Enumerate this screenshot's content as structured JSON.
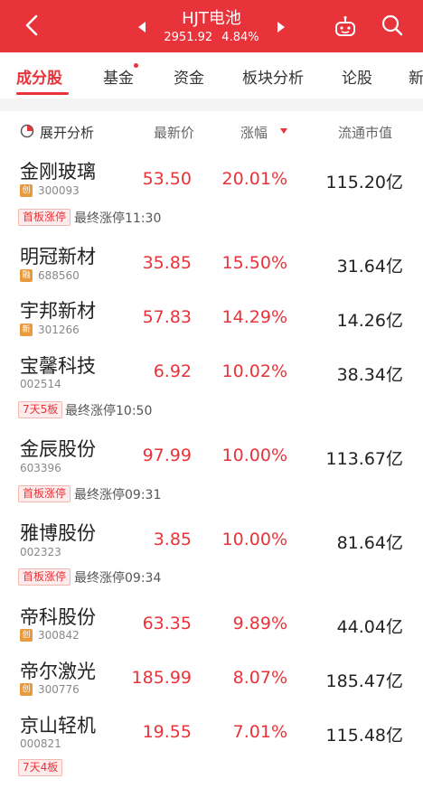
{
  "header": {
    "title": "HJT电池",
    "index_value": "2951.92",
    "index_change": "4.84%",
    "accent_color": "#e8333a",
    "icons": [
      "back-icon",
      "prev-arrow-icon",
      "next-arrow-icon",
      "robot-icon",
      "search-icon"
    ]
  },
  "tabs": [
    {
      "label": "成分股",
      "active": true
    },
    {
      "label": "基金",
      "has_dot": true
    },
    {
      "label": "资金"
    },
    {
      "label": "板块分析"
    },
    {
      "label": "论股"
    },
    {
      "label": "新"
    }
  ],
  "columns": {
    "expand": "展开分析",
    "price": "最新价",
    "change": "涨幅",
    "cap": "流通市值"
  },
  "rows": [
    {
      "name": "金刚玻璃",
      "badge": "创",
      "code": "300093",
      "price": "53.50",
      "change": "20.01%",
      "cap": "115.20亿",
      "tag": "首板涨停",
      "tag_note": "最终涨停11:30"
    },
    {
      "name": "明冠新材",
      "badge": "融",
      "code": "688560",
      "price": "35.85",
      "change": "15.50%",
      "cap": "31.64亿"
    },
    {
      "name": "宇邦新材",
      "badge": "新",
      "code": "301266",
      "price": "57.83",
      "change": "14.29%",
      "cap": "14.26亿"
    },
    {
      "name": "宝馨科技",
      "code": "002514",
      "price": "6.92",
      "change": "10.02%",
      "cap": "38.34亿",
      "tag": "7天5板",
      "tag_note": "最终涨停10:50"
    },
    {
      "name": "金辰股份",
      "code": "603396",
      "price": "97.99",
      "change": "10.00%",
      "cap": "113.67亿",
      "tag": "首板涨停",
      "tag_note": "最终涨停09:31"
    },
    {
      "name": "雅博股份",
      "code": "002323",
      "price": "3.85",
      "change": "10.00%",
      "cap": "81.64亿",
      "tag": "首板涨停",
      "tag_note": "最终涨停09:34"
    },
    {
      "name": "帝科股份",
      "badge": "创",
      "code": "300842",
      "price": "63.35",
      "change": "9.89%",
      "cap": "44.04亿"
    },
    {
      "name": "帝尔激光",
      "badge": "创",
      "code": "300776",
      "price": "185.99",
      "change": "8.07%",
      "cap": "185.47亿"
    },
    {
      "name": "京山轻机",
      "code": "000821",
      "price": "19.55",
      "change": "7.01%",
      "cap": "115.48亿",
      "tag": "7天4板"
    }
  ]
}
